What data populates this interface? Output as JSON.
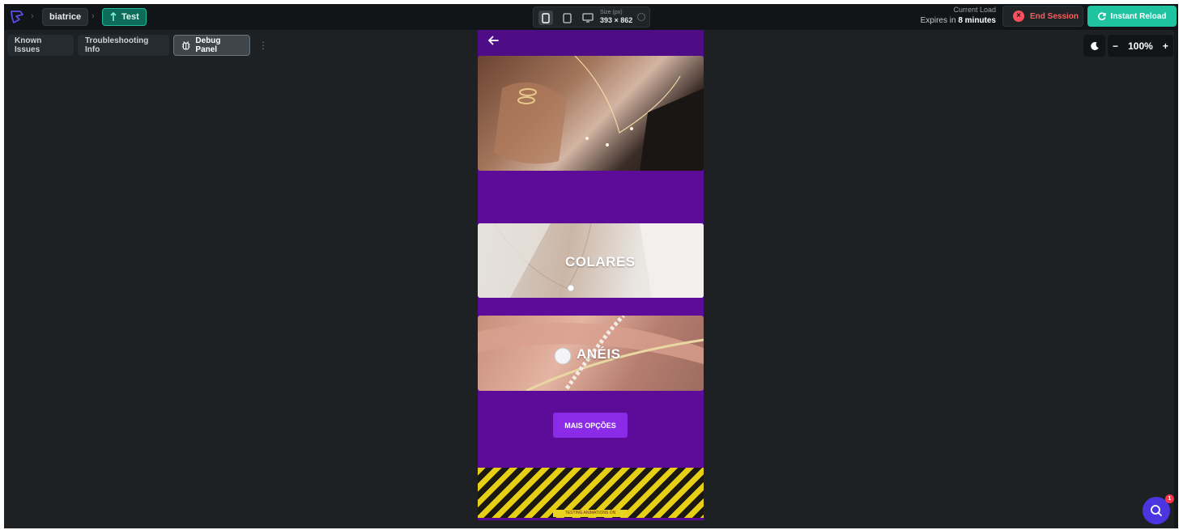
{
  "header": {
    "user": "biatrice",
    "branch": "Test",
    "device_size_label": "Size (px)",
    "device_size_value": "393 × 862",
    "load_label": "Current Load",
    "expires_prefix": "Expires in",
    "expires_value": "8 minutes",
    "end_session": "End Session",
    "instant_reload": "Instant Reload"
  },
  "toolbar": {
    "known_issues": "Known Issues",
    "troubleshooting": "Troubleshooting Info",
    "debug_panel": "Debug Panel",
    "zoom_minus": "−",
    "zoom_level": "100%",
    "zoom_plus": "+"
  },
  "preview": {
    "category_1": "COLARES",
    "category_2": "ANÉIS",
    "more_options": "MAIS OPÇÕES",
    "stripe_text": "TESTING ANIMATIONS ON SIMULATOR"
  },
  "help": {
    "badge_count": "1"
  },
  "colors": {
    "accent_teal": "#1fc3a0",
    "danger": "#ff4f5e",
    "preview_purple": "#5c0c98",
    "button_purple": "#8b2be8"
  },
  "icons": [
    "logo-icon",
    "branch-icon",
    "phone-icon",
    "tablet-icon",
    "desktop-icon",
    "info-icon",
    "close-circle-icon",
    "reload-icon",
    "debug-icon",
    "more-vertical-icon",
    "moon-icon",
    "back-arrow-icon",
    "search-help-icon"
  ]
}
